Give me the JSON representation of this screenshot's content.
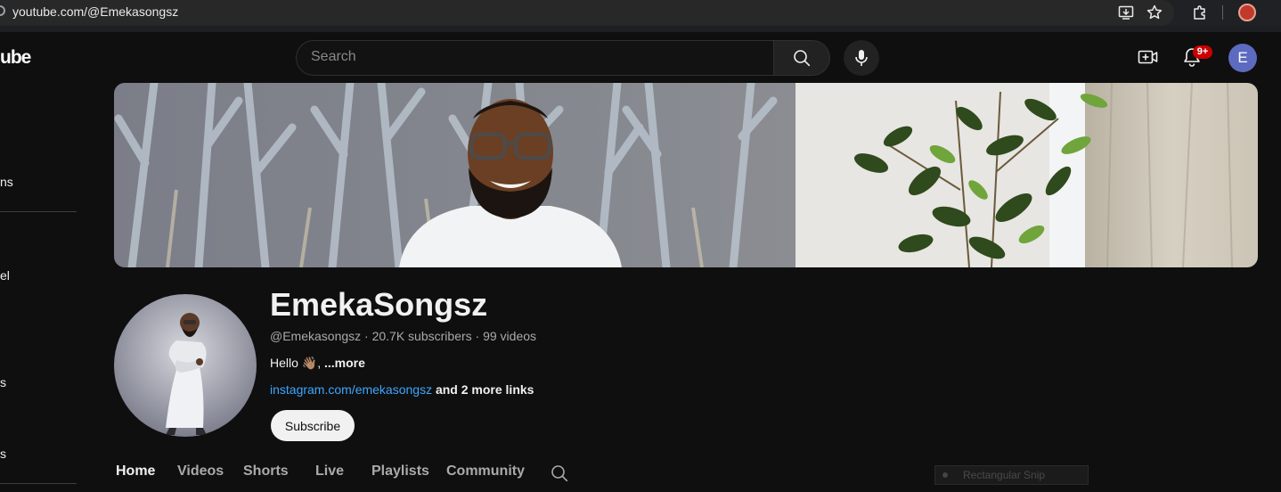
{
  "browser": {
    "url": "youtube.com/@Emekasongsz",
    "icons": [
      "install-app-icon",
      "bookmark-star-icon",
      "extensions-icon",
      "profile-icon"
    ]
  },
  "sidebar": {
    "logo_fragment": "ube",
    "items": [
      {
        "label": "ns"
      },
      {
        "label": "el"
      },
      {
        "label": "s"
      },
      {
        "label": "s"
      }
    ]
  },
  "topbar": {
    "search_placeholder": "Search",
    "notification_count": "9+",
    "avatar_letter": "E"
  },
  "channel": {
    "name": "EmekaSongsz",
    "meta": "@Emekasongsz · 20.7K subscribers · 99 videos",
    "description": "Hello 👋🏽, ",
    "more_label": "...more",
    "link": "instagram.com/emekasongsz",
    "more_links": " and 2 more links",
    "subscribe_label": "Subscribe"
  },
  "tabs": [
    {
      "label": "Home",
      "active": true
    },
    {
      "label": "Videos",
      "active": false
    },
    {
      "label": "Shorts",
      "active": false
    },
    {
      "label": "Live",
      "active": false
    },
    {
      "label": "Playlists",
      "active": false
    },
    {
      "label": "Community",
      "active": false
    }
  ],
  "overlay": {
    "snip_label": "Rectangular Snip"
  },
  "colors": {
    "background": "#0f0f0f",
    "link": "#3ea6ff",
    "badge": "#cc0000",
    "avatar": "#5c6bc0"
  }
}
